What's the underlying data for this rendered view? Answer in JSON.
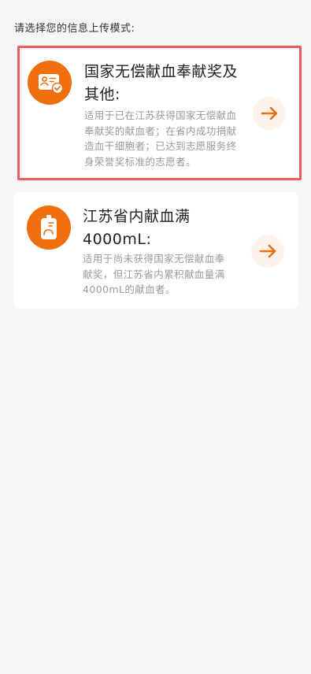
{
  "prompt": "请选择您的信息上传模式:",
  "options": [
    {
      "title": "国家无偿献血奉献奖及其他:",
      "description": "适用于已在江苏获得国家无偿献血奉献奖的献血者；在省内成功捐献造血干细胞者；已达到志愿服务终身荣誉奖标准的志愿者。",
      "icon": "certificate-icon",
      "selected": true
    },
    {
      "title": "江苏省内献血满4000mL:",
      "description": "适用于尚未获得国家无偿献血奉献奖，但江苏省内累积献血量满4000mL的献血者。",
      "icon": "blood-bag-icon",
      "selected": false
    }
  ],
  "colors": {
    "accent": "#ef6e0e",
    "selected_border": "#ee5a5e",
    "arrow_bg": "#fdf3ec",
    "page_bg": "#f5f6f8"
  }
}
